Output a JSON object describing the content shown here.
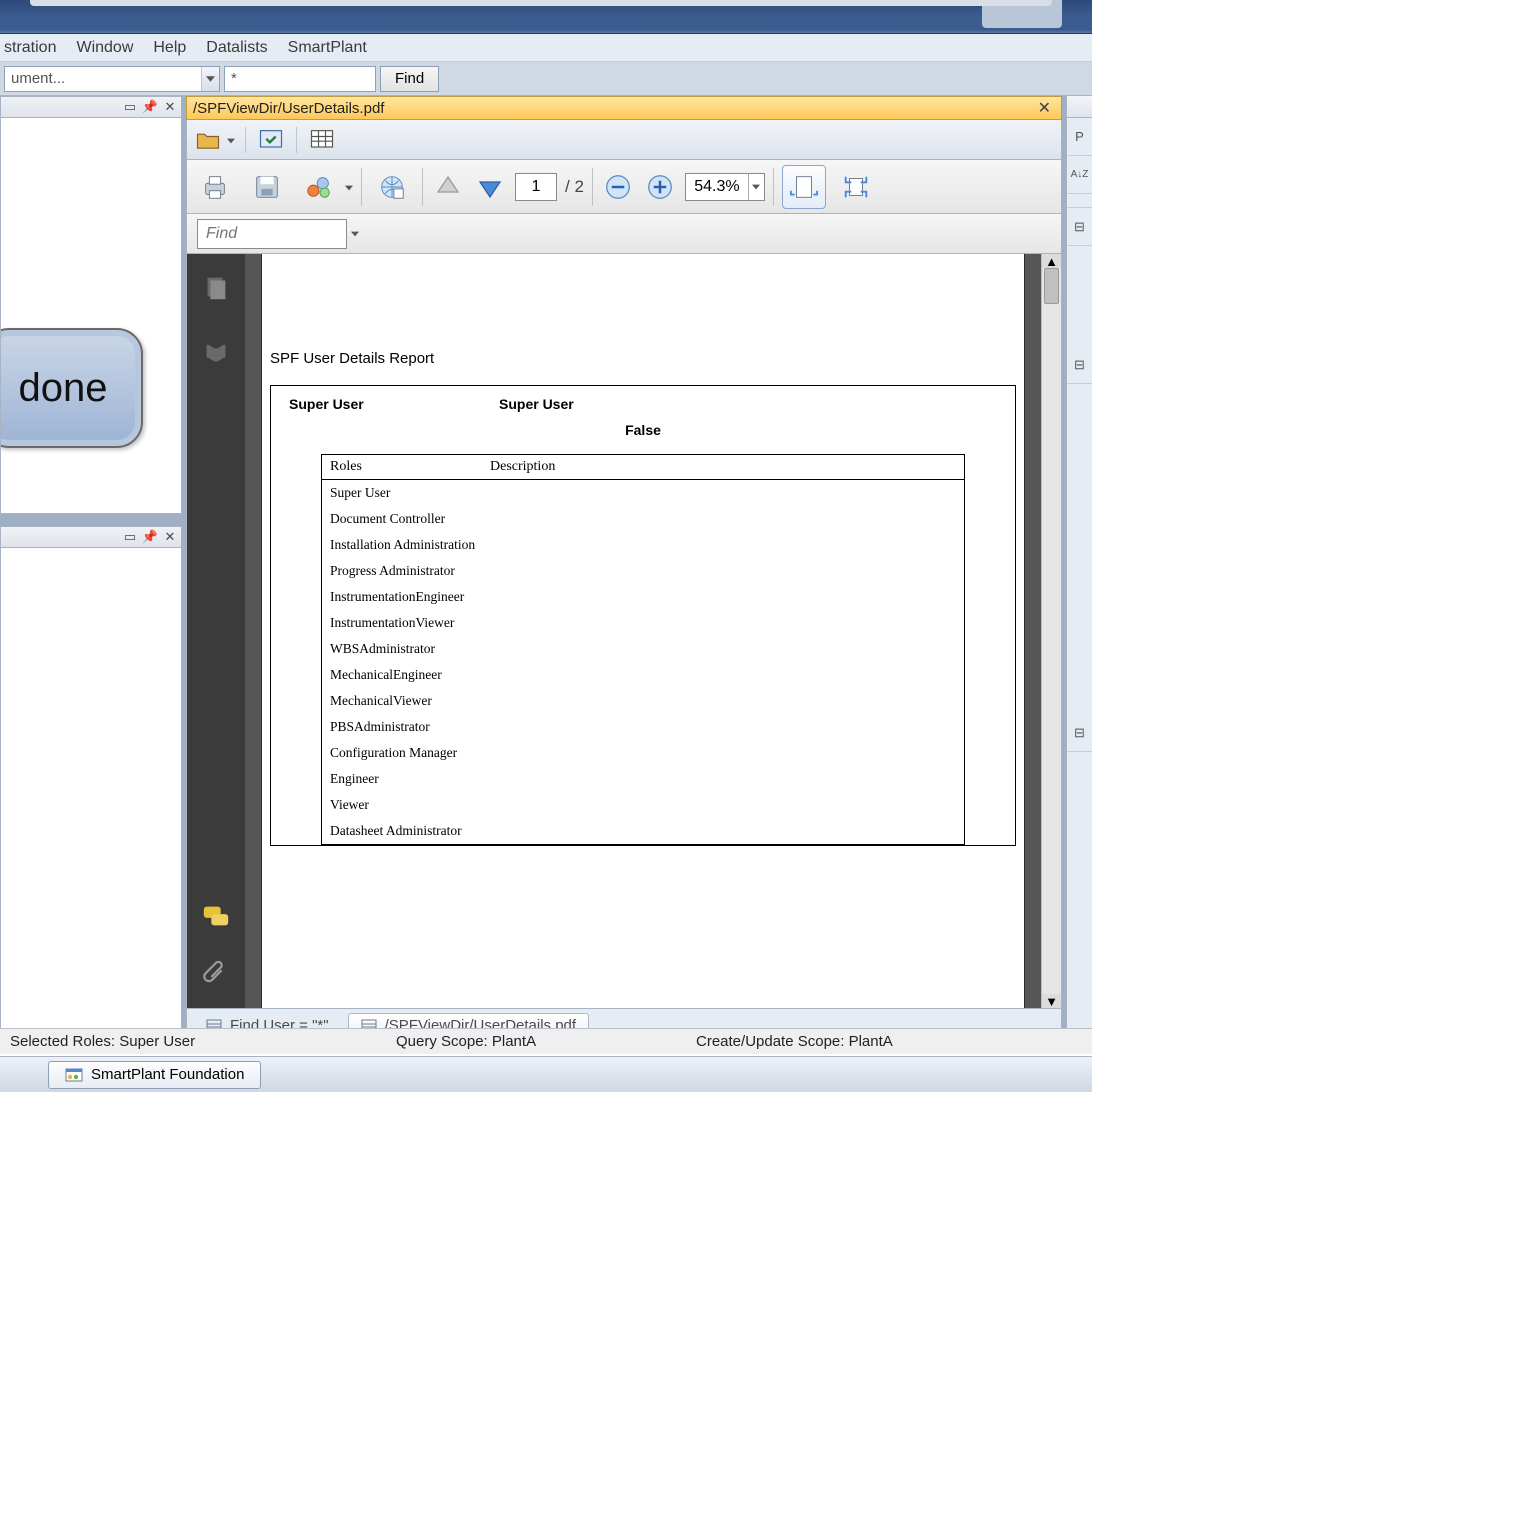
{
  "menubar": {
    "items": [
      "stration",
      "Window",
      "Help",
      "Datalists",
      "SmartPlant"
    ]
  },
  "search": {
    "combo_value": "ument...",
    "filter_value": "*",
    "find_label": "Find"
  },
  "left_panel": {
    "bubble_text": "done"
  },
  "document": {
    "tab_title": "/SPFViewDir/UserDetails.pdf",
    "page_current": "1",
    "page_total": "/ 2",
    "zoom": "54.3%",
    "find_placeholder": "Find"
  },
  "report": {
    "title": "SPF User Details Report",
    "header_left": "Super User",
    "header_right": "Super User",
    "header_bool": "False",
    "columns": {
      "roles": "Roles",
      "desc": "Description"
    },
    "rows": [
      "Super User",
      "Document Controller",
      "Installation Administration",
      "Progress Administrator",
      "InstrumentationEngineer",
      "InstrumentationViewer",
      "WBSAdministrator",
      "MechanicalEngineer",
      "MechanicalViewer",
      "PBSAdministrator",
      "Configuration Manager",
      "Engineer",
      "Viewer",
      "Datasheet Administrator"
    ]
  },
  "bottom_tabs": {
    "tab1": "Find User = \"*\"",
    "tab2": "/SPFViewDir/UserDetails.pdf"
  },
  "statusbar": {
    "roles": "Selected Roles: Super User",
    "query": "Query Scope: PlantA",
    "create": "Create/Update Scope: PlantA"
  },
  "taskbar": {
    "app": "SmartPlant Foundation"
  },
  "right_strip": {
    "az": "A↓Z",
    "p": "P"
  }
}
